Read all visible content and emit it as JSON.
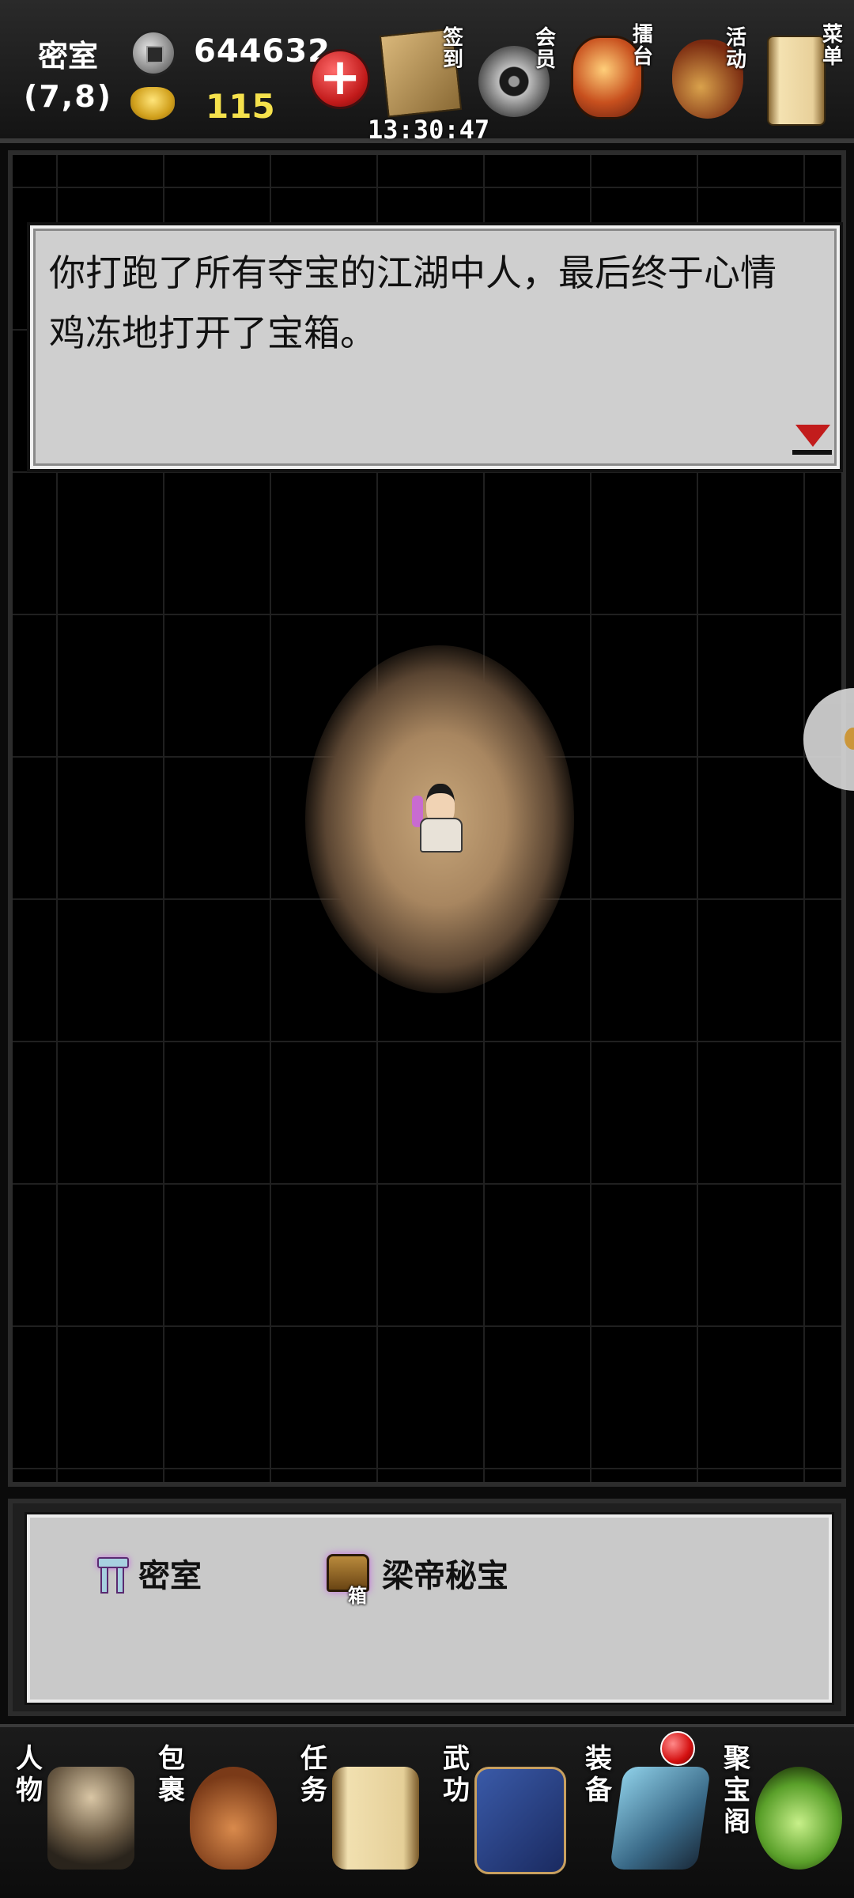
{
  "status": {
    "location_name": "密室",
    "location_coords": "(7,8)",
    "coins": "644632",
    "gold": "115",
    "clock": "13:30:47"
  },
  "top_menu": [
    {
      "label": "签到",
      "icon": "sign-in-scroll-icon"
    },
    {
      "label": "会员",
      "icon": "vip-coin-icon"
    },
    {
      "label": "擂台",
      "icon": "arena-drum-icon"
    },
    {
      "label": "活动",
      "icon": "event-gourd-icon"
    },
    {
      "label": "菜单",
      "icon": "menu-scroll-icon"
    }
  ],
  "dialog": {
    "text": "你打跑了所有夺宝的江湖中人，最后终于心情鸡冻地打开了宝箱。"
  },
  "info_panel": {
    "room_label": "密室",
    "chest_label": "梁帝秘宝",
    "chest_tag": "箱"
  },
  "bottom_nav": [
    {
      "label": "人物",
      "icon": "character-icon"
    },
    {
      "label": "包裹",
      "icon": "bag-icon"
    },
    {
      "label": "任务",
      "icon": "quest-scroll-icon"
    },
    {
      "label": "武功",
      "icon": "martial-arts-book-icon"
    },
    {
      "label": "装备",
      "icon": "equipment-icon"
    },
    {
      "label": "聚宝阁",
      "icon": "treasure-shop-icon"
    }
  ],
  "colors": {
    "gold_text": "#f5e14c",
    "dialog_bg": "#cfcfcf",
    "accent_red": "#c21c1c",
    "highlight_purple": "#c46be0"
  }
}
